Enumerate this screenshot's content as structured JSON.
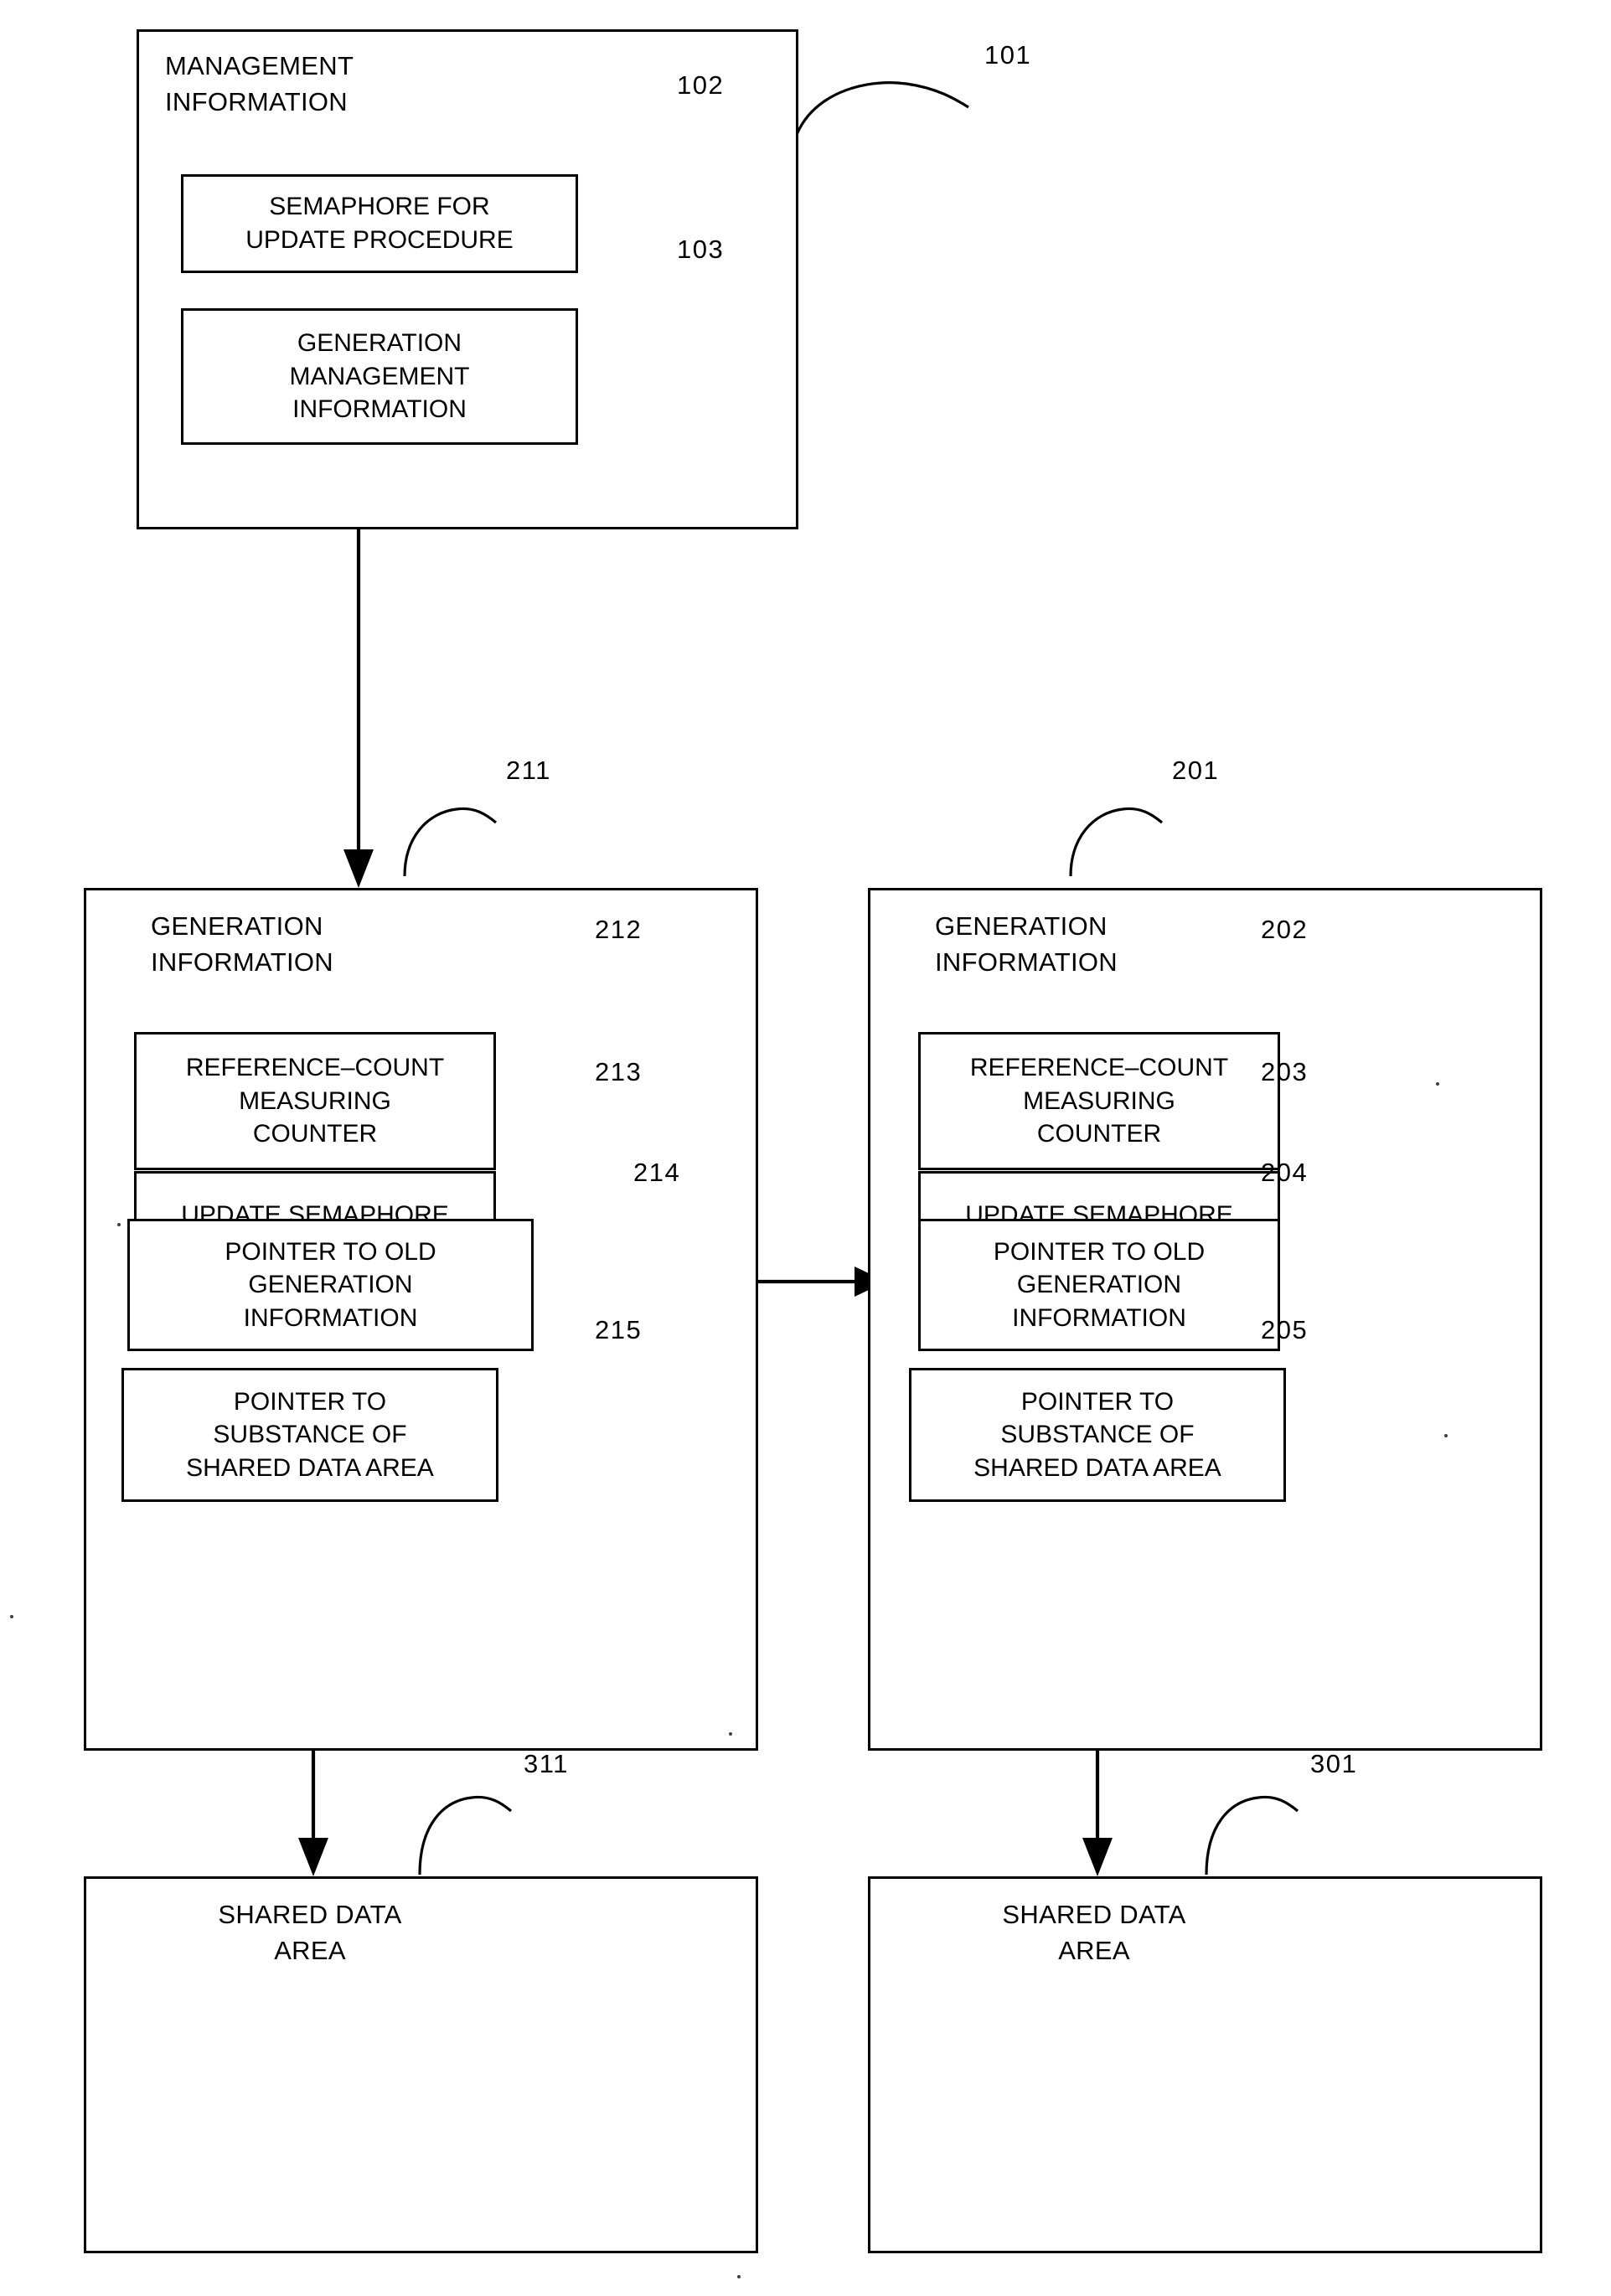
{
  "figure": {
    "management_block": {
      "title": "MANAGEMENT\nINFORMATION",
      "ref": "101",
      "fields": [
        {
          "label": "SEMAPHORE FOR\nUPDATE PROCEDURE",
          "ref": "102"
        },
        {
          "label": "GENERATION\nMANAGEMENT\nINFORMATION",
          "ref": "103"
        }
      ]
    },
    "generation_blocks": [
      {
        "title": "GENERATION\nINFORMATION",
        "ref": "211",
        "fields": [
          {
            "label": "REFERENCE–COUNT\nMEASURING\nCOUNTER",
            "ref": "212"
          },
          {
            "label": "UPDATE SEMAPHORE",
            "ref": "213"
          },
          {
            "label": "POINTER TO OLD\nGENERATION\nINFORMATION",
            "ref": "214"
          },
          {
            "label": "POINTER TO\nSUBSTANCE OF\nSHARED DATA AREA",
            "ref": "215"
          }
        ]
      },
      {
        "title": "GENERATION\nINFORMATION",
        "ref": "201",
        "fields": [
          {
            "label": "REFERENCE–COUNT\nMEASURING\nCOUNTER",
            "ref": "202"
          },
          {
            "label": "UPDATE SEMAPHORE",
            "ref": "203"
          },
          {
            "label": "POINTER TO OLD\nGENERATION\nINFORMATION",
            "ref": "204"
          },
          {
            "label": "POINTER TO\nSUBSTANCE OF\nSHARED DATA AREA",
            "ref": "205"
          }
        ]
      }
    ],
    "shared_data_blocks": [
      {
        "title": "SHARED DATA\nAREA",
        "ref": "311"
      },
      {
        "title": "SHARED DATA\nAREA",
        "ref": "301"
      }
    ],
    "colors": {
      "stroke": "#000000",
      "background": "#ffffff"
    }
  }
}
